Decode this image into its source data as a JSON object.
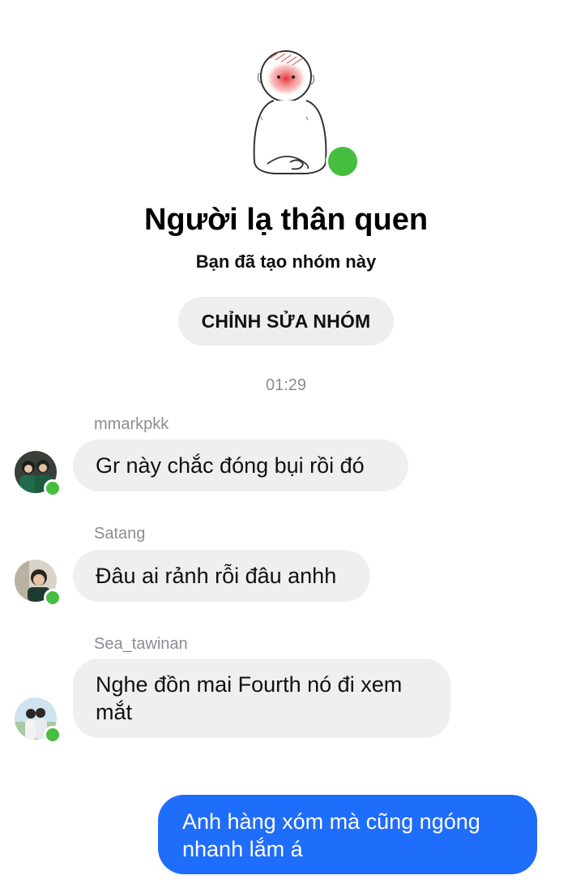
{
  "group": {
    "title": "Người lạ thân quen",
    "subtitle": "Bạn đã tạo nhóm này",
    "edit_button": "CHỈNH SỬA NHÓM",
    "online_color": "#45bd3f"
  },
  "timestamp": "01:29",
  "messages": [
    {
      "sender": "mmarkpkk",
      "text": "Gr này chắc đóng bụi rồi đó",
      "online": true
    },
    {
      "sender": "Satang",
      "text": "Đâu ai rảnh rỗi đâu anhh",
      "online": true
    },
    {
      "sender": "Sea_tawinan",
      "text": "Nghe đồn mai Fourth nó đi xem mắt",
      "online": true
    }
  ],
  "outgoing": {
    "text": "Anh hàng xóm mà cũng ngóng nhanh lắm á",
    "bubble_color": "#1f6dfb"
  }
}
